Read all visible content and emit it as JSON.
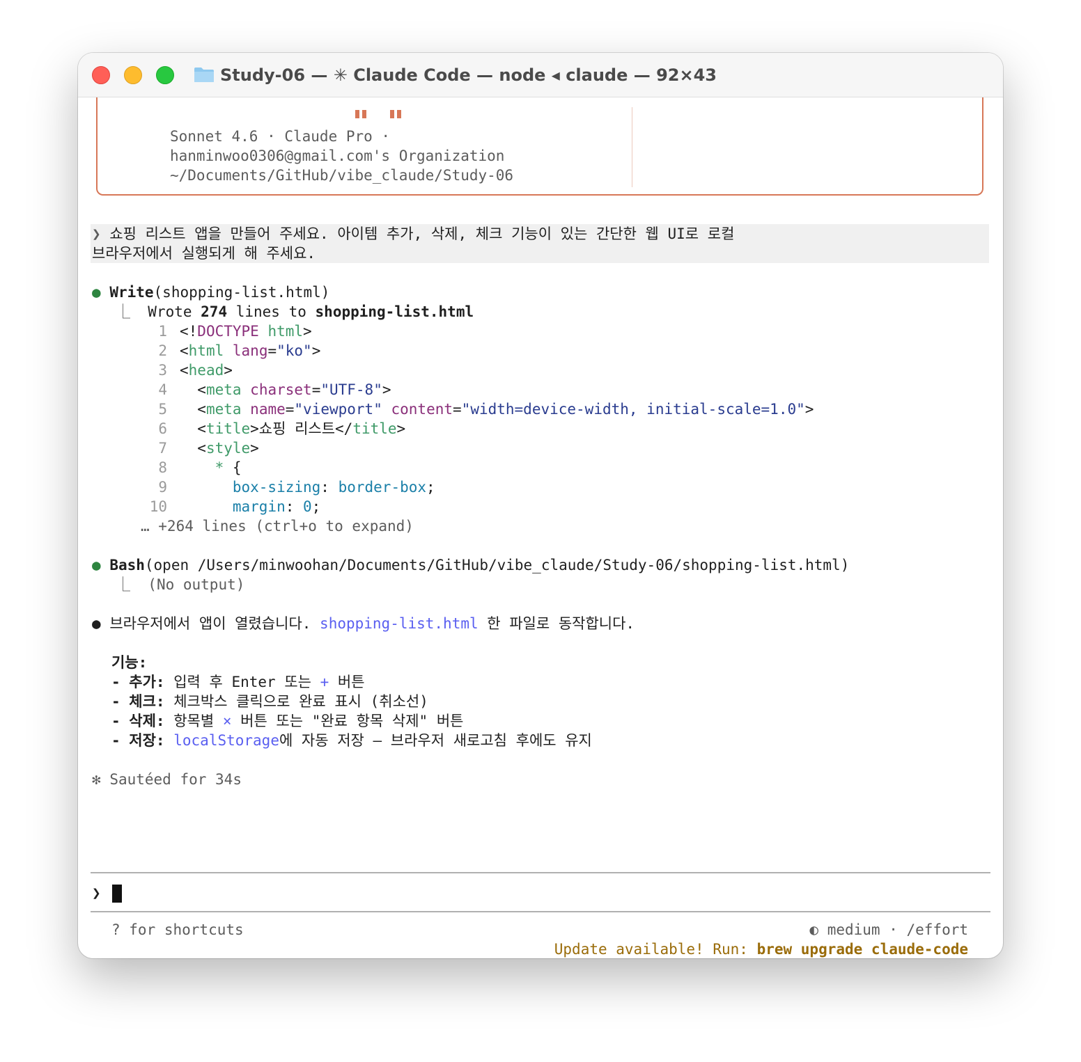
{
  "window": {
    "title": "Study-06 — ✳ Claude Code — node ◂ claude — 92×43"
  },
  "welcome": {
    "model_line": "Sonnet 4.6 · Claude Pro ·",
    "org_line": "hanminwoo0306@gmail.com's Organization",
    "path_line": "~/Documents/GitHub/vibe_claude/Study-06"
  },
  "user_prompt": {
    "marker": "❯",
    "line1": "쇼핑 리스트 앱을 만들어 주세요. 아이템 추가, 삭제, 체크 기능이 있는 간단한 웹 UI로 로컬",
    "line2": "브라우저에서 실행되게 해 주세요."
  },
  "write_tool": {
    "bullet": "●",
    "name": "Write",
    "arg": "(shopping-list.html)",
    "result_branch": "⎿",
    "result_prefix": "Wrote ",
    "result_count": "274",
    "result_mid": " lines to ",
    "result_file": "shopping-list.html",
    "code": [
      {
        "num": "1",
        "tokens": [
          [
            "p",
            "<!"
          ],
          [
            "purple",
            "DOCTYPE"
          ],
          [
            "p",
            " "
          ],
          [
            "green",
            "html"
          ],
          [
            "p",
            ">"
          ]
        ]
      },
      {
        "num": "2",
        "tokens": [
          [
            "p",
            "<"
          ],
          [
            "green",
            "html"
          ],
          [
            "p",
            " "
          ],
          [
            "purple",
            "lang"
          ],
          [
            "p",
            "="
          ],
          [
            "navy",
            "\"ko\""
          ],
          [
            "p",
            ">"
          ]
        ]
      },
      {
        "num": "3",
        "tokens": [
          [
            "p",
            "<"
          ],
          [
            "green",
            "head"
          ],
          [
            "p",
            ">"
          ]
        ]
      },
      {
        "num": "4",
        "tokens": [
          [
            "p",
            "  <"
          ],
          [
            "green",
            "meta"
          ],
          [
            "p",
            " "
          ],
          [
            "purple",
            "charset"
          ],
          [
            "p",
            "="
          ],
          [
            "navy",
            "\"UTF-8\""
          ],
          [
            "p",
            ">"
          ]
        ]
      },
      {
        "num": "5",
        "tokens": [
          [
            "p",
            "  <"
          ],
          [
            "green",
            "meta"
          ],
          [
            "p",
            " "
          ],
          [
            "purple",
            "name"
          ],
          [
            "p",
            "="
          ],
          [
            "navy",
            "\"viewport\""
          ],
          [
            "p",
            " "
          ],
          [
            "purple",
            "content"
          ],
          [
            "p",
            "="
          ],
          [
            "navy",
            "\"width=device-width, initial-scale=1.0\""
          ],
          [
            "p",
            ">"
          ]
        ]
      },
      {
        "num": "6",
        "tokens": [
          [
            "p",
            "  <"
          ],
          [
            "green",
            "title"
          ],
          [
            "p",
            ">쇼핑 리스트</"
          ],
          [
            "green",
            "title"
          ],
          [
            "p",
            ">"
          ]
        ]
      },
      {
        "num": "7",
        "tokens": [
          [
            "p",
            "  <"
          ],
          [
            "green",
            "style"
          ],
          [
            "p",
            ">"
          ]
        ]
      },
      {
        "num": "8",
        "tokens": [
          [
            "p",
            "    "
          ],
          [
            "green",
            "*"
          ],
          [
            "p",
            " {"
          ]
        ]
      },
      {
        "num": "9",
        "tokens": [
          [
            "p",
            "      "
          ],
          [
            "teal",
            "box-sizing"
          ],
          [
            "p",
            ": "
          ],
          [
            "teal",
            "border-box"
          ],
          [
            "p",
            ";"
          ]
        ]
      },
      {
        "num": "10",
        "tokens": [
          [
            "p",
            "      "
          ],
          [
            "teal",
            "margin"
          ],
          [
            "p",
            ": "
          ],
          [
            "teal",
            "0"
          ],
          [
            "p",
            ";"
          ]
        ]
      }
    ],
    "more_lines": "… +264 lines (ctrl+o to expand)"
  },
  "bash_tool": {
    "bullet": "●",
    "name": "Bash",
    "arg": "(open /Users/minwoohan/Documents/GitHub/vibe_claude/Study-06/shopping-list.html)",
    "result_branch": "⎿",
    "result": "(No output)"
  },
  "assistant": {
    "bullet": "●",
    "msg_prefix": "브라우저에서 앱이 열렸습니다. ",
    "msg_file": "shopping-list.html",
    "msg_suffix": " 한 파일로 동작합니다.",
    "features_heading": "기능:",
    "features": [
      {
        "dash": "- ",
        "label": "추가:",
        "before": " 입력 후 Enter 또는 ",
        "code": "+",
        "after": " 버튼"
      },
      {
        "dash": "- ",
        "label": "체크:",
        "before": " 체크박스 클릭으로 완료 표시 (취소선)",
        "code": "",
        "after": ""
      },
      {
        "dash": "- ",
        "label": "삭제:",
        "before": " 항목별 ",
        "code": "×",
        "after": " 버튼 또는 \"완료 항목 삭제\" 버튼"
      },
      {
        "dash": "- ",
        "label": "저장:",
        "before": " ",
        "code": "localStorage",
        "after": "에 자동 저장 — 브라우저 새로고침 후에도 유지"
      }
    ]
  },
  "status": {
    "spinner": "✻",
    "text": "Sautéed for 34s"
  },
  "input": {
    "prompt": "❯"
  },
  "footer": {
    "shortcuts": "? for shortcuts",
    "effort_icon": "◐",
    "effort_text": "medium · /effort",
    "update_prefix": "Update available! Run: ",
    "update_cmd": "brew upgrade claude-code"
  },
  "colors": {
    "accent": "#d77757",
    "success": "#2e8540",
    "link": "#5a5ff0",
    "warning": "#9a6c0a"
  }
}
